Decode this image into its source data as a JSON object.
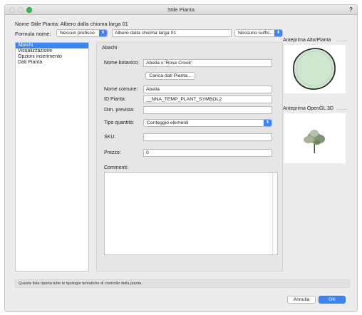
{
  "window": {
    "title": "Stile Pianta",
    "help": "?"
  },
  "header": {
    "style_name": "Nome Stile Pianta: Albero dalla chioma larga 01",
    "formula_label": "Formula nome:",
    "prefix_value": "Nessun prefisso",
    "name_value": "Albero dalla chioma larga 01",
    "suffix_value": "Nessuno suffis..."
  },
  "sidebar": {
    "items": [
      {
        "label": "Abachi",
        "selected": true
      },
      {
        "label": "Visualizzazione",
        "selected": false
      },
      {
        "label": "Opzioni inserimento",
        "selected": false
      },
      {
        "label": "Dati Pianta",
        "selected": false
      }
    ]
  },
  "panel": {
    "title": "Abachi",
    "botanical_label": "Nome botanico:",
    "botanical_value": "Abelia x 'Rose Creek'",
    "load_button": "Carica dati Pianta...",
    "common_label": "Nome comune:",
    "common_value": "Abelia",
    "id_label": "ID Pianta:",
    "id_value": "__NNA_TEMP_PLANT_SYMBOL2",
    "size_label": "Dim. prevista:",
    "size_value": "",
    "qty_label": "Tipo quantità:",
    "qty_value": "Conteggio elementi",
    "sku_label": "SKU:",
    "sku_value": "",
    "price_label": "Prezzo:",
    "price_value": "0",
    "comments_label": "Commenti:"
  },
  "previews": {
    "top_label": "Anteprima Alto/Pianta",
    "opengl_label": "Anteprima OpenGL 3D"
  },
  "status": {
    "text": "Questa lista riporta tutte le tipologie tematiche di controllo della pianta."
  },
  "footer": {
    "cancel": "Annulla",
    "ok": "OK"
  },
  "colors": {
    "accent": "#3b86f7",
    "canopy_fill": "#cfe6cf",
    "canopy_stroke": "#1a1a1a"
  }
}
